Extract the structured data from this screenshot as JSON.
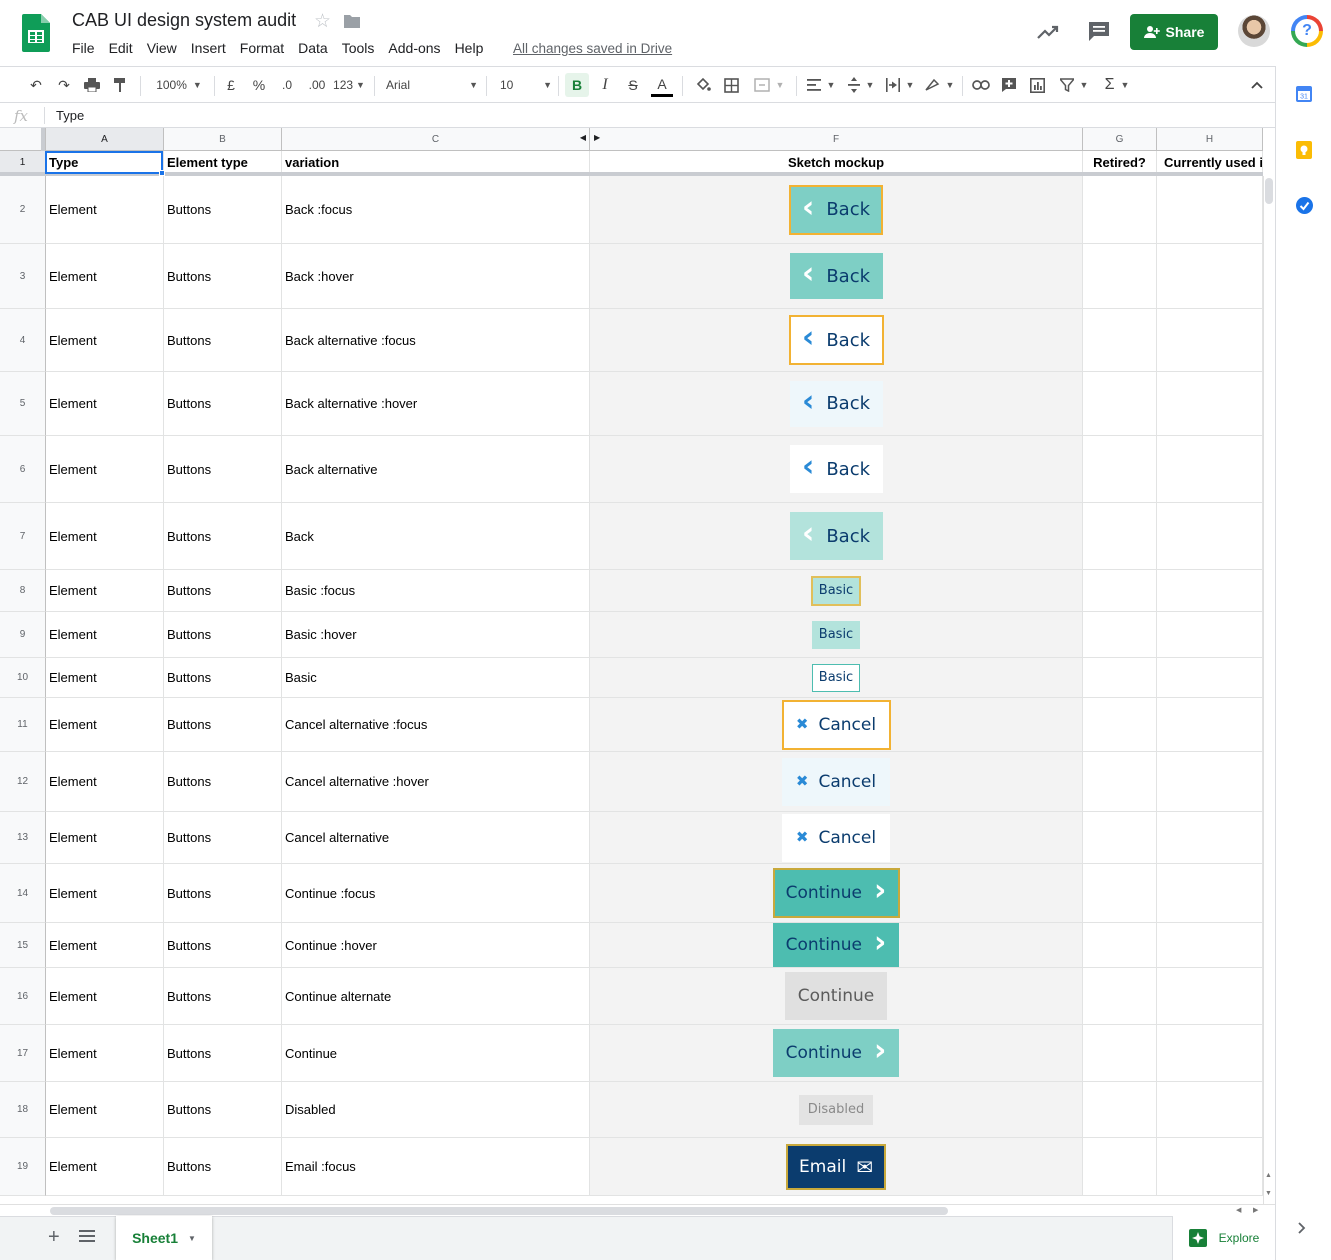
{
  "header": {
    "title": "CAB UI design system audit",
    "menu": [
      "File",
      "Edit",
      "View",
      "Insert",
      "Format",
      "Data",
      "Tools",
      "Add-ons",
      "Help"
    ],
    "save_status": "All changes saved in Drive",
    "share_label": "Share"
  },
  "toolbar": {
    "zoom": "100%",
    "currency": "£",
    "percent": "%",
    "decrease_decimal": ".0",
    "increase_decimal": ".00",
    "more_formats": "123",
    "font": "Arial",
    "font_size": "10",
    "bold": "B",
    "italic": "I",
    "strike": "S",
    "text_color": "A"
  },
  "formula_bar": {
    "fx": "fx",
    "value": "Type"
  },
  "columns": [
    "A",
    "B",
    "C",
    "F",
    "G",
    "H"
  ],
  "header_row": {
    "num": "1",
    "a": "Type",
    "b": "Element type",
    "c": "variation",
    "f": "Sketch mockup",
    "g": "Retired?",
    "h": "Currently used i"
  },
  "rows": [
    {
      "num": "2",
      "a": "Element",
      "b": "Buttons",
      "c": "Back :focus",
      "mock": {
        "label": "Back",
        "icon": "chevron-left-icon",
        "glyph": "‹"
      }
    },
    {
      "num": "3",
      "a": "Element",
      "b": "Buttons",
      "c": "Back :hover",
      "mock": {
        "label": "Back",
        "icon": "chevron-left-icon",
        "glyph": "‹"
      }
    },
    {
      "num": "4",
      "a": "Element",
      "b": "Buttons",
      "c": "Back alternative :focus",
      "mock": {
        "label": "Back",
        "icon": "chevron-left-icon",
        "glyph": "‹"
      }
    },
    {
      "num": "5",
      "a": "Element",
      "b": "Buttons",
      "c": "Back alternative :hover",
      "mock": {
        "label": "Back",
        "icon": "chevron-left-icon",
        "glyph": "‹"
      }
    },
    {
      "num": "6",
      "a": "Element",
      "b": "Buttons",
      "c": "Back alternative",
      "mock": {
        "label": "Back",
        "icon": "chevron-left-icon",
        "glyph": "‹"
      }
    },
    {
      "num": "7",
      "a": "Element",
      "b": "Buttons",
      "c": "Back",
      "mock": {
        "label": "Back",
        "icon": "chevron-left-icon",
        "glyph": "‹"
      }
    },
    {
      "num": "8",
      "a": "Element",
      "b": "Buttons",
      "c": "Basic :focus",
      "mock": {
        "label": "Basic"
      }
    },
    {
      "num": "9",
      "a": "Element",
      "b": "Buttons",
      "c": "Basic :hover",
      "mock": {
        "label": "Basic"
      }
    },
    {
      "num": "10",
      "a": "Element",
      "b": "Buttons",
      "c": "Basic",
      "mock": {
        "label": "Basic"
      }
    },
    {
      "num": "11",
      "a": "Element",
      "b": "Buttons",
      "c": "Cancel alternative :focus",
      "mock": {
        "label": "Cancel",
        "icon": "close-icon",
        "glyph": "✖"
      }
    },
    {
      "num": "12",
      "a": "Element",
      "b": "Buttons",
      "c": "Cancel alternative :hover",
      "mock": {
        "label": "Cancel",
        "icon": "close-icon",
        "glyph": "✖"
      }
    },
    {
      "num": "13",
      "a": "Element",
      "b": "Buttons",
      "c": "Cancel alternative",
      "mock": {
        "label": "Cancel",
        "icon": "close-icon",
        "glyph": "✖"
      }
    },
    {
      "num": "14",
      "a": "Element",
      "b": "Buttons",
      "c": "Continue :focus",
      "mock": {
        "label": "Continue",
        "icon": "chevron-right-icon",
        "glyph": "›"
      }
    },
    {
      "num": "15",
      "a": "Element",
      "b": "Buttons",
      "c": "Continue :hover",
      "mock": {
        "label": "Continue",
        "icon": "chevron-right-icon",
        "glyph": "›"
      }
    },
    {
      "num": "16",
      "a": "Element",
      "b": "Buttons",
      "c": "Continue alternate",
      "mock": {
        "label": "Continue"
      }
    },
    {
      "num": "17",
      "a": "Element",
      "b": "Buttons",
      "c": "Continue",
      "mock": {
        "label": "Continue",
        "icon": "chevron-right-icon",
        "glyph": "›"
      }
    },
    {
      "num": "18",
      "a": "Element",
      "b": "Buttons",
      "c": "Disabled",
      "mock": {
        "label": "Disabled"
      }
    },
    {
      "num": "19",
      "a": "Element",
      "b": "Buttons",
      "c": "Email :focus",
      "mock": {
        "label": "Email",
        "icon": "mail-icon",
        "glyph": "✉"
      }
    }
  ],
  "bottom": {
    "add_sheet": "+",
    "sheet_tab": "Sheet1",
    "explore": "Explore"
  },
  "colors": {
    "brand_green": "#188038",
    "teal": "#7ecfc5",
    "teal_dark": "#4dbdb0",
    "navy": "#0b3c6e",
    "focus_orange": "#f2b233",
    "chevron_blue": "#2a8ad6"
  }
}
